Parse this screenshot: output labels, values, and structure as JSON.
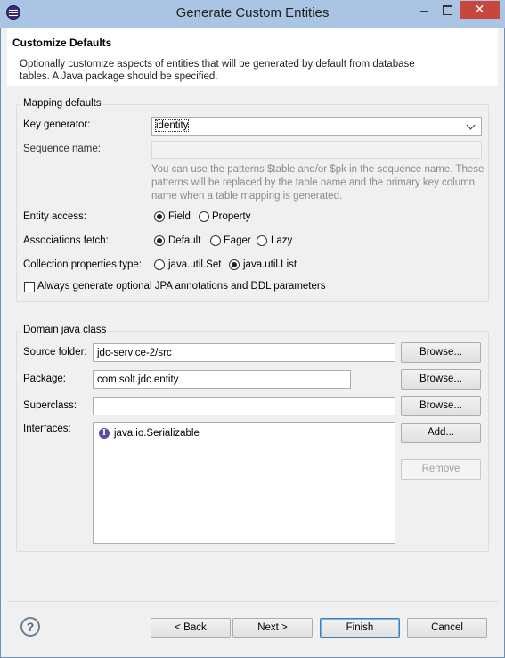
{
  "window": {
    "title": "Generate Custom Entities",
    "close_glyph": "✕"
  },
  "header": {
    "title": "Customize Defaults",
    "description": "Optionally customize aspects of entities that will be generated by default from database tables. A Java package should be specified."
  },
  "mapping": {
    "group_label": "Mapping defaults",
    "key_generator": {
      "label": "Key generator:",
      "value": "identity"
    },
    "sequence_name": {
      "label": "Sequence name:",
      "value": ""
    },
    "hint": "You can use the patterns $table and/or $pk in the sequence name. These patterns will be replaced by the table name and the primary key column name when a table mapping is generated.",
    "entity_access": {
      "label": "Entity access:",
      "options": [
        "Field",
        "Property"
      ],
      "selected": "Field"
    },
    "associations_fetch": {
      "label": "Associations fetch:",
      "options": [
        "Default",
        "Eager",
        "Lazy"
      ],
      "selected": "Default"
    },
    "collection_type": {
      "label": "Collection properties type:",
      "options": [
        "java.util.Set",
        "java.util.List"
      ],
      "selected": "java.util.List"
    },
    "always_generate": {
      "label": "Always generate optional JPA annotations and DDL parameters",
      "checked": false
    }
  },
  "domain": {
    "group_label": "Domain java class",
    "source_folder": {
      "label": "Source folder:",
      "value": "jdc-service-2/src",
      "button": "Browse..."
    },
    "package": {
      "label": "Package:",
      "value": "com.solt.jdc.entity",
      "button": "Browse..."
    },
    "superclass": {
      "label": "Superclass:",
      "value": "",
      "button": "Browse..."
    },
    "interfaces": {
      "label": "Interfaces:",
      "items": [
        "java.io.Serializable"
      ],
      "icon_letter": "I",
      "add_button": "Add...",
      "remove_button": "Remove"
    }
  },
  "footer": {
    "help_glyph": "?",
    "back": "< Back",
    "next": "Next >",
    "finish": "Finish",
    "cancel": "Cancel"
  },
  "colors": {
    "titlebar": "#a9c5e3",
    "close": "#c7463e",
    "default_button_border": "#3c7fb1"
  }
}
